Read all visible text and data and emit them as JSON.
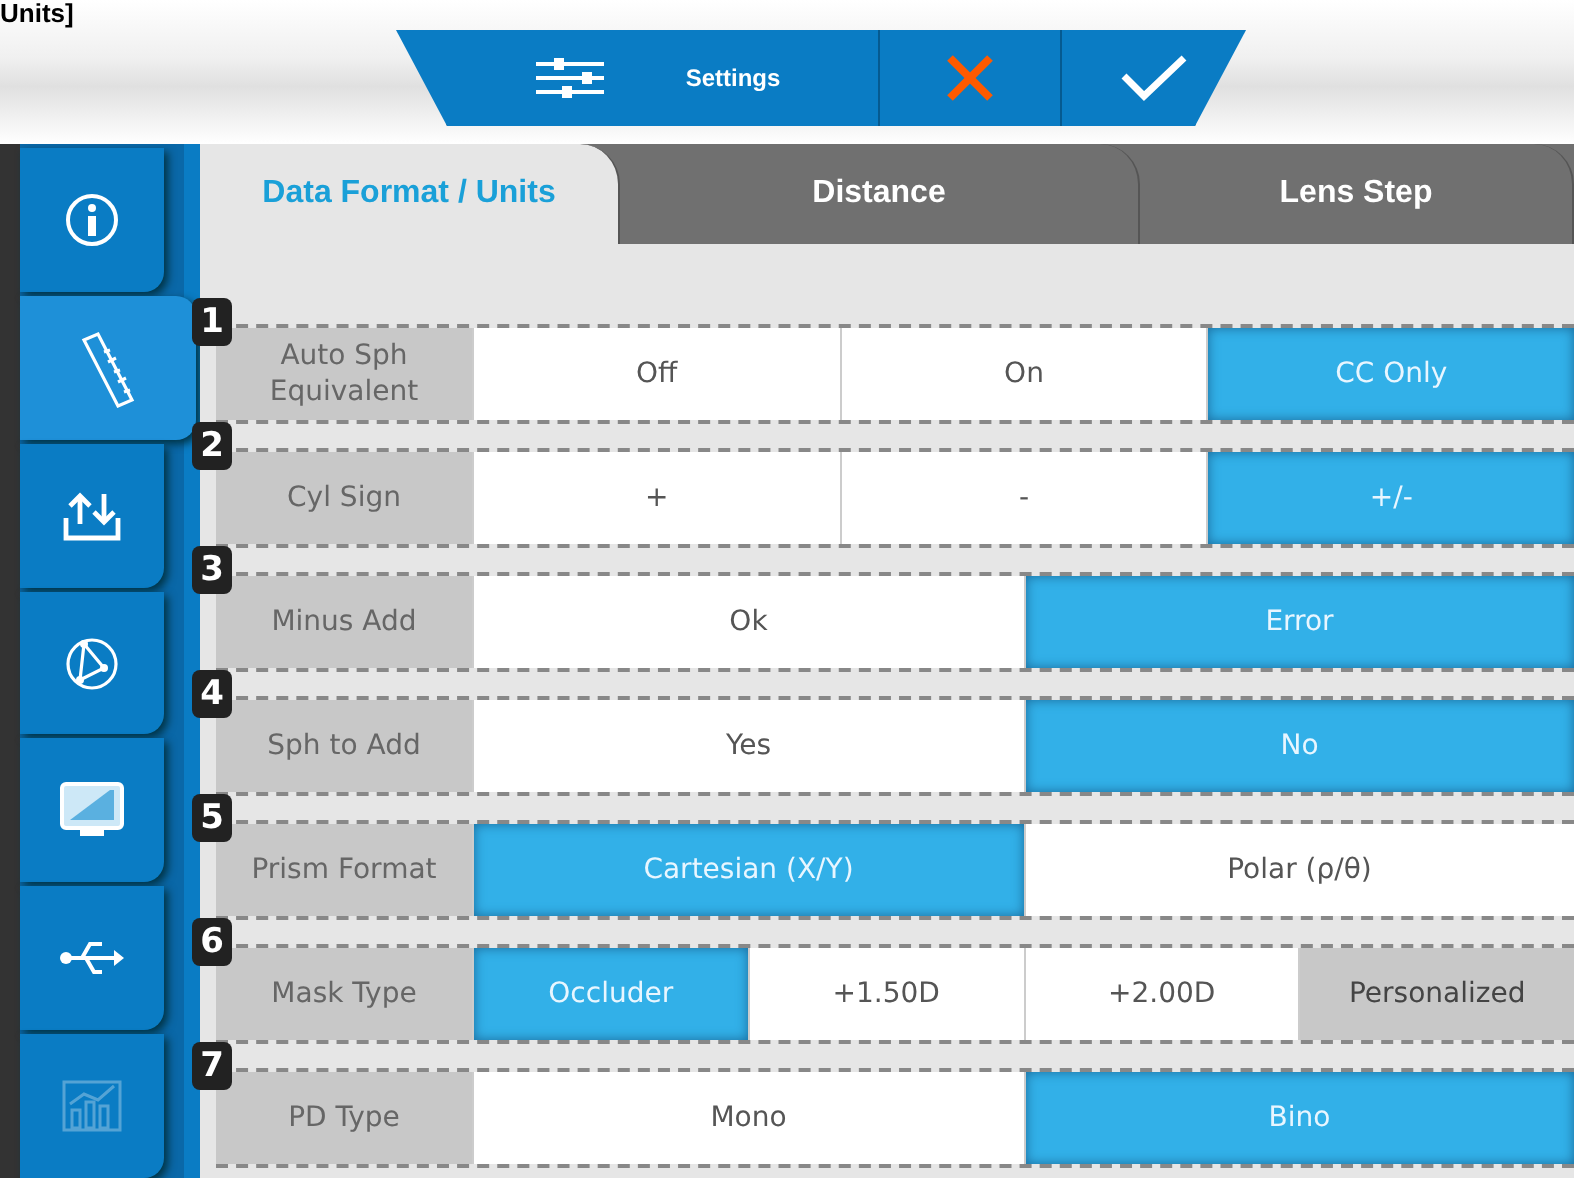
{
  "caption": "Units]",
  "toolbar": {
    "title": "Settings"
  },
  "sidebar": {
    "items": [
      {
        "kind": "info",
        "selected": false,
        "disabled": false
      },
      {
        "kind": "ruler",
        "selected": true,
        "disabled": false
      },
      {
        "kind": "transfer",
        "selected": false,
        "disabled": false
      },
      {
        "kind": "gauge",
        "selected": false,
        "disabled": false
      },
      {
        "kind": "monitor",
        "selected": false,
        "disabled": false
      },
      {
        "kind": "usb",
        "selected": false,
        "disabled": false
      },
      {
        "kind": "chart",
        "selected": false,
        "disabled": true
      }
    ]
  },
  "tabs": [
    {
      "label": "Data Format / Units",
      "selected": true
    },
    {
      "label": "Distance",
      "selected": false
    },
    {
      "label": "Lens Step",
      "selected": false
    }
  ],
  "settings": [
    {
      "number": "1",
      "label": "Auto Sph Equivalent",
      "options": [
        {
          "label": "Off",
          "selected": false,
          "disabled": false
        },
        {
          "label": "On",
          "selected": false,
          "disabled": false
        },
        {
          "label": "CC Only",
          "selected": true,
          "disabled": false
        }
      ]
    },
    {
      "number": "2",
      "label": "Cyl Sign",
      "options": [
        {
          "label": "+",
          "selected": false,
          "disabled": false
        },
        {
          "label": "-",
          "selected": false,
          "disabled": false
        },
        {
          "label": "+/-",
          "selected": true,
          "disabled": false
        }
      ]
    },
    {
      "number": "3",
      "label": "Minus Add",
      "options": [
        {
          "label": "Ok",
          "selected": false,
          "disabled": false
        },
        {
          "label": "Error",
          "selected": true,
          "disabled": false
        }
      ]
    },
    {
      "number": "4",
      "label": "Sph to Add",
      "options": [
        {
          "label": "Yes",
          "selected": false,
          "disabled": false
        },
        {
          "label": "No",
          "selected": true,
          "disabled": false
        }
      ]
    },
    {
      "number": "5",
      "label": "Prism Format",
      "options": [
        {
          "label": "Cartesian (X/Y)",
          "selected": true,
          "disabled": false
        },
        {
          "label": "Polar (ρ/θ)",
          "selected": false,
          "disabled": false
        }
      ]
    },
    {
      "number": "6",
      "label": "Mask Type",
      "options": [
        {
          "label": "Occluder",
          "selected": true,
          "disabled": false
        },
        {
          "label": "+1.50D",
          "selected": false,
          "disabled": false
        },
        {
          "label": "+2.00D",
          "selected": false,
          "disabled": false
        },
        {
          "label": "Personalized",
          "selected": false,
          "disabled": true
        }
      ]
    },
    {
      "number": "7",
      "label": "PD Type",
      "options": [
        {
          "label": "Mono",
          "selected": false,
          "disabled": false
        },
        {
          "label": "Bino",
          "selected": true,
          "disabled": false
        }
      ]
    }
  ]
}
